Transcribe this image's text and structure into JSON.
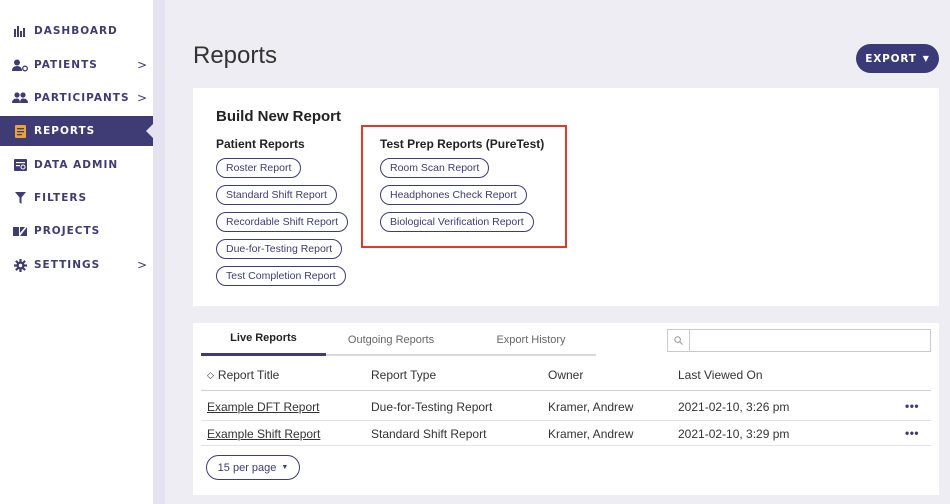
{
  "sidebar": {
    "items": [
      {
        "label": "DASHBOARD",
        "icon": "bar-chart-icon",
        "has_chevron": false
      },
      {
        "label": "PATIENTS",
        "icon": "patient-icon",
        "has_chevron": true
      },
      {
        "label": "PARTICIPANTS",
        "icon": "participants-icon",
        "has_chevron": true
      },
      {
        "label": "REPORTS",
        "icon": "report-icon",
        "has_chevron": false,
        "active": true
      },
      {
        "label": "DATA ADMIN",
        "icon": "data-admin-icon",
        "has_chevron": false
      },
      {
        "label": "FILTERS",
        "icon": "filter-icon",
        "has_chevron": false
      },
      {
        "label": "PROJECTS",
        "icon": "projects-icon",
        "has_chevron": false
      },
      {
        "label": "SETTINGS",
        "icon": "gear-icon",
        "has_chevron": true
      }
    ],
    "chevron": ">"
  },
  "header": {
    "title": "Reports",
    "export_label": "EXPORT",
    "export_caret": "▼"
  },
  "build": {
    "title": "Build New Report",
    "patient": {
      "heading": "Patient Reports",
      "items": [
        "Roster Report",
        "Standard Shift Report",
        "Recordable Shift Report",
        "Due-for-Testing Report",
        "Test Completion Report"
      ]
    },
    "testprep": {
      "heading": "Test Prep Reports (PureTest)",
      "items": [
        "Room Scan Report",
        "Headphones Check Report",
        "Biological Verification Report"
      ]
    }
  },
  "reports": {
    "tabs": [
      "Live Reports",
      "Outgoing Reports",
      "Export History"
    ],
    "search": {
      "placeholder": "",
      "value": ""
    },
    "columns": [
      "Report Title",
      "Report Type",
      "Owner",
      "Last Viewed On"
    ],
    "rows": [
      {
        "title": "Example DFT Report",
        "type": "Due-for-Testing Report",
        "owner": "Kramer, Andrew",
        "viewed": "2021-02-10, 3:26 pm",
        "menu": "•••"
      },
      {
        "title": "Example Shift Report",
        "type": "Standard Shift Report",
        "owner": "Kramer, Andrew",
        "viewed": "2021-02-10, 3:29 pm",
        "menu": "•••"
      }
    ],
    "per_page": "15 per page",
    "per_page_caret": "▼",
    "sort_glyph": "◇"
  },
  "colors": {
    "brand": "#3f3b75",
    "highlight": "#dd3b2b",
    "background": "#eeedf3"
  }
}
